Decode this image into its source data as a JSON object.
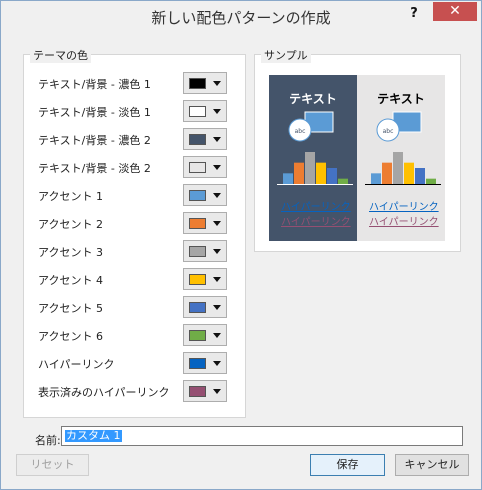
{
  "dialog": {
    "title": "新しい配色パターンの作成",
    "help_label": "?",
    "close_label": "✕"
  },
  "theme_colors": {
    "legend": "テーマの色",
    "rows": [
      {
        "label": "テキスト/背景 - 濃色 1",
        "color": "#000000"
      },
      {
        "label": "テキスト/背景 - 淡色 1",
        "color": "#ffffff"
      },
      {
        "label": "テキスト/背景 - 濃色 2",
        "color": "#44546a"
      },
      {
        "label": "テキスト/背景 - 淡色 2",
        "color": "#e7e6e6"
      },
      {
        "label": "アクセント 1",
        "color": "#5b9bd5"
      },
      {
        "label": "アクセント 2",
        "color": "#ed7d31"
      },
      {
        "label": "アクセント 3",
        "color": "#a5a5a5"
      },
      {
        "label": "アクセント 4",
        "color": "#ffc000"
      },
      {
        "label": "アクセント 5",
        "color": "#4472c4"
      },
      {
        "label": "アクセント 6",
        "color": "#70ad47"
      },
      {
        "label": "ハイパーリンク",
        "color": "#0563c1"
      },
      {
        "label": "表示済みのハイパーリンク",
        "color": "#954f72"
      }
    ]
  },
  "sample": {
    "legend": "サンプル",
    "dark_title": "テキスト",
    "light_title": "テキスト",
    "hyperlink": "ハイパーリンク",
    "visited_hyperlink": "ハイパーリンク",
    "chart_values": [
      2,
      4,
      6,
      4,
      3,
      1
    ]
  },
  "name": {
    "label": "名前:",
    "value": "カスタム 1"
  },
  "buttons": {
    "reset": "リセット",
    "save": "保存",
    "cancel": "キャンセル"
  },
  "colors": {
    "dark_text": "#ffffff",
    "light_text": "#000000",
    "hyperlink": "#0563c1",
    "visited": "#954f72"
  }
}
